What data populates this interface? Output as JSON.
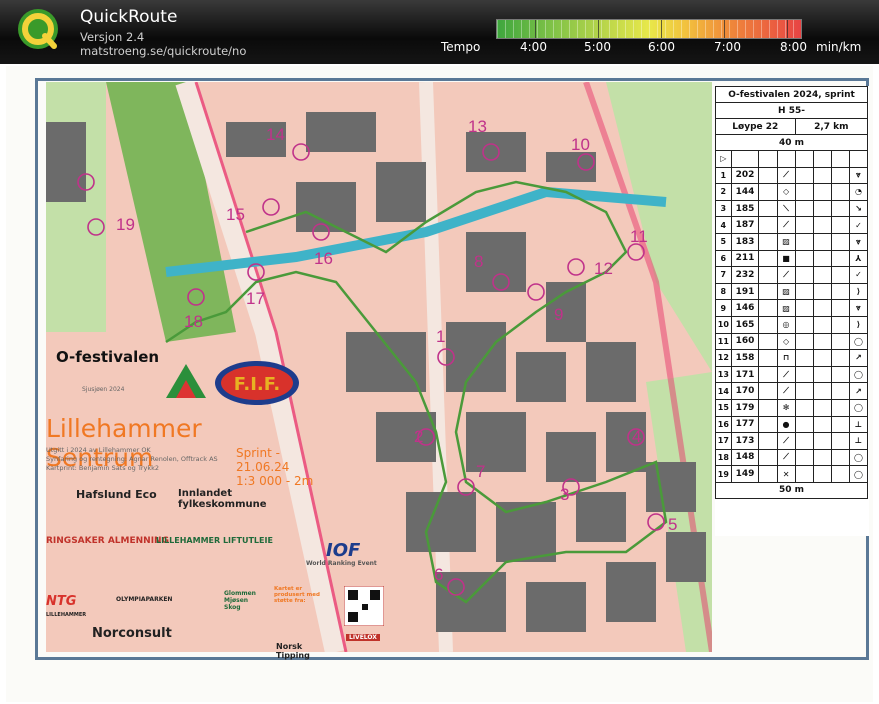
{
  "app": {
    "name": "QuickRoute",
    "version": "Versjon 2.4",
    "url": "matstroeng.se/quickroute/no"
  },
  "tempo": {
    "label": "Tempo",
    "ticks": [
      "4:00",
      "5:00",
      "6:00",
      "7:00",
      "8:00"
    ],
    "unit": "min/km",
    "colors": [
      "#3ea63e",
      "#b5d44a",
      "#e8e84a",
      "#ef8a3a",
      "#e84444"
    ]
  },
  "map": {
    "controls": [
      "1",
      "2",
      "3",
      "4",
      "5",
      "6",
      "7",
      "8",
      "9",
      "10",
      "11",
      "12",
      "13",
      "14",
      "15",
      "16",
      "17",
      "18",
      "19"
    ],
    "colors": {
      "course": "#c0328a",
      "route": "#4a9a3a",
      "water": "#3fb3c8",
      "buildings": "#6b6b6b",
      "road": "#e8386c"
    }
  },
  "info": {
    "festival": "O-festivalen",
    "festival_sub": "Sjusjøen 2024",
    "club": "F.I.F.",
    "title": "Lillehammer Sentrum",
    "credits": [
      "Utgitt i 2024 av Lillehammer OK",
      "Synfaring og rentegning: Agnar Renolen, Offtrack AS",
      "Kartprint: Benjamin Sats og Trykk2"
    ],
    "race": [
      "Sprint - 21.06.24",
      "1:3 000 - 2m"
    ],
    "sponsors": [
      "Hafslund Eco",
      "Innlandet fylkeskommune",
      "RINGSAKER ALMENNING",
      "LILLEHAMMER LIFTUTLEIE",
      "World Ranking Event",
      "OLYMPIAPARKEN",
      "Glommen Mjøsen Skog",
      "Norsk Tipping",
      "LIVELOX",
      "Norconsult",
      "LILLEHAMMER"
    ],
    "iof": "IOF",
    "ntg": "NTG",
    "map_made_by": "Kartet er produsert med støtte fra:"
  },
  "control_description": {
    "title": "O-festivalen 2024, sprint",
    "class": "H 55-",
    "course": "Løype 22",
    "length": "2,7 km",
    "start_leg": "40 m",
    "finish_leg": "50 m",
    "rows": [
      {
        "n": "1",
        "code": "202"
      },
      {
        "n": "2",
        "code": "144"
      },
      {
        "n": "3",
        "code": "185"
      },
      {
        "n": "4",
        "code": "187"
      },
      {
        "n": "5",
        "code": "183"
      },
      {
        "n": "6",
        "code": "211"
      },
      {
        "n": "7",
        "code": "232"
      },
      {
        "n": "8",
        "code": "191"
      },
      {
        "n": "9",
        "code": "146"
      },
      {
        "n": "10",
        "code": "165"
      },
      {
        "n": "11",
        "code": "160"
      },
      {
        "n": "12",
        "code": "158"
      },
      {
        "n": "13",
        "code": "171"
      },
      {
        "n": "14",
        "code": "170"
      },
      {
        "n": "15",
        "code": "179"
      },
      {
        "n": "16",
        "code": "177"
      },
      {
        "n": "17",
        "code": "173"
      },
      {
        "n": "18",
        "code": "148"
      },
      {
        "n": "19",
        "code": "149"
      }
    ]
  }
}
